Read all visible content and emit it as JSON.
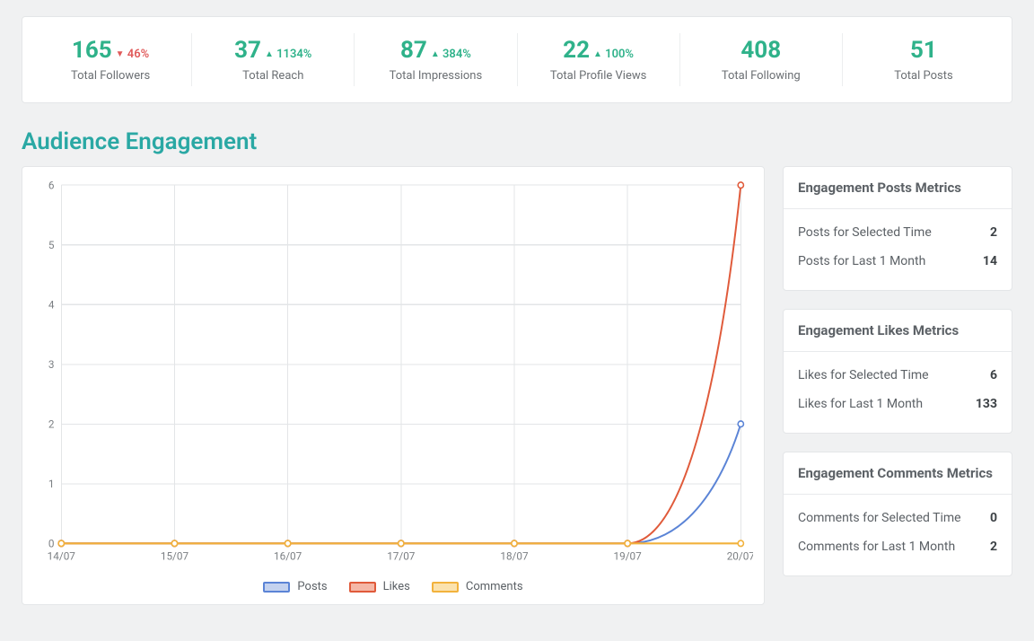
{
  "stats": [
    {
      "value": "165",
      "delta_dir": "down",
      "delta_pct": "46%",
      "label": "Total Followers"
    },
    {
      "value": "37",
      "delta_dir": "up",
      "delta_pct": "1134%",
      "label": "Total Reach"
    },
    {
      "value": "87",
      "delta_dir": "up",
      "delta_pct": "384%",
      "label": "Total Impressions"
    },
    {
      "value": "22",
      "delta_dir": "up",
      "delta_pct": "100%",
      "label": "Total Profile Views"
    },
    {
      "value": "408",
      "delta_dir": null,
      "delta_pct": null,
      "label": "Total Following"
    },
    {
      "value": "51",
      "delta_dir": null,
      "delta_pct": null,
      "label": "Total Posts"
    }
  ],
  "section_title": "Audience Engagement",
  "side_metrics": [
    {
      "title": "Engagement Posts Metrics",
      "rows": [
        {
          "label": "Posts for Selected Time",
          "value": "2"
        },
        {
          "label": "Posts for Last 1 Month",
          "value": "14"
        }
      ]
    },
    {
      "title": "Engagement Likes Metrics",
      "rows": [
        {
          "label": "Likes for Selected Time",
          "value": "6"
        },
        {
          "label": "Likes for Last 1 Month",
          "value": "133"
        }
      ]
    },
    {
      "title": "Engagement Comments Metrics",
      "rows": [
        {
          "label": "Comments for Selected Time",
          "value": "0"
        },
        {
          "label": "Comments for Last 1 Month",
          "value": "2"
        }
      ]
    }
  ],
  "chart_data": {
    "type": "line",
    "title": "",
    "xlabel": "",
    "ylabel": "",
    "ylim": [
      0,
      6
    ],
    "yticks": [
      0,
      1,
      2,
      3,
      4,
      5,
      6
    ],
    "categories": [
      "14/07",
      "15/07",
      "16/07",
      "17/07",
      "18/07",
      "19/07",
      "20/07"
    ],
    "series": [
      {
        "name": "Posts",
        "color": "#5b84d6",
        "fill": "#c4d2ef",
        "values": [
          0,
          0,
          0,
          0,
          0,
          0,
          2
        ]
      },
      {
        "name": "Likes",
        "color": "#e05a3a",
        "fill": "#f5b7a6",
        "values": [
          0,
          0,
          0,
          0,
          0,
          0,
          6
        ]
      },
      {
        "name": "Comments",
        "color": "#f2b23c",
        "fill": "#fbe2ad",
        "values": [
          0,
          0,
          0,
          0,
          0,
          0,
          0
        ]
      }
    ],
    "legend_position": "bottom",
    "grid": true
  }
}
